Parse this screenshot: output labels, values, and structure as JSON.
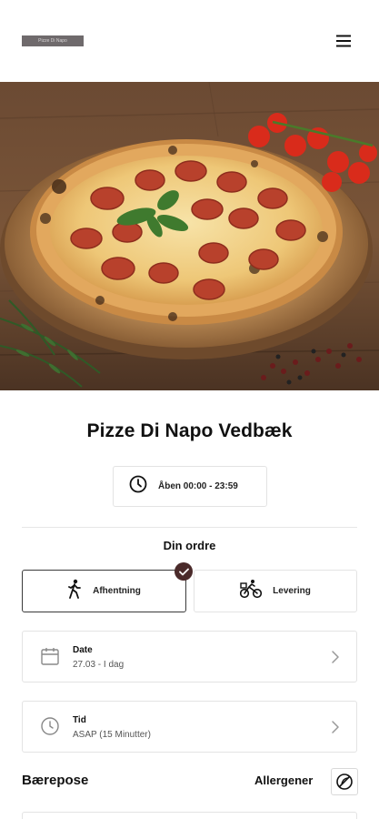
{
  "header": {
    "logo_text": "Pizze Di Napo",
    "menu_icon": "hamburger-menu-icon"
  },
  "hero": {
    "image_description_icon": "pizza-photo"
  },
  "restaurant": {
    "name": "Pizze Di Napo Vedbæk",
    "hours": "Åben 00:00 - 23:59",
    "hours_icon": "clock-icon"
  },
  "order": {
    "title": "Din ordre",
    "modes": [
      {
        "label": "Afhentning",
        "icon": "walking-person-icon",
        "selected": true
      },
      {
        "label": "Levering",
        "icon": "bicycle-courier-icon",
        "selected": false
      }
    ]
  },
  "date_card": {
    "label": "Date",
    "value": "27.03 - I dag",
    "icon": "calendar-icon"
  },
  "time_card": {
    "label": "Tid",
    "value": "ASAP (15 Minutter)",
    "icon": "clock-icon"
  },
  "footer_row": {
    "bag_label": "Bærepose",
    "allergen_label": "Allergener",
    "allergen_icon": "no-allergen-icon"
  },
  "colors": {
    "accent": "#4a2a2a",
    "border": "#e3e3e3",
    "text": "#111111"
  }
}
